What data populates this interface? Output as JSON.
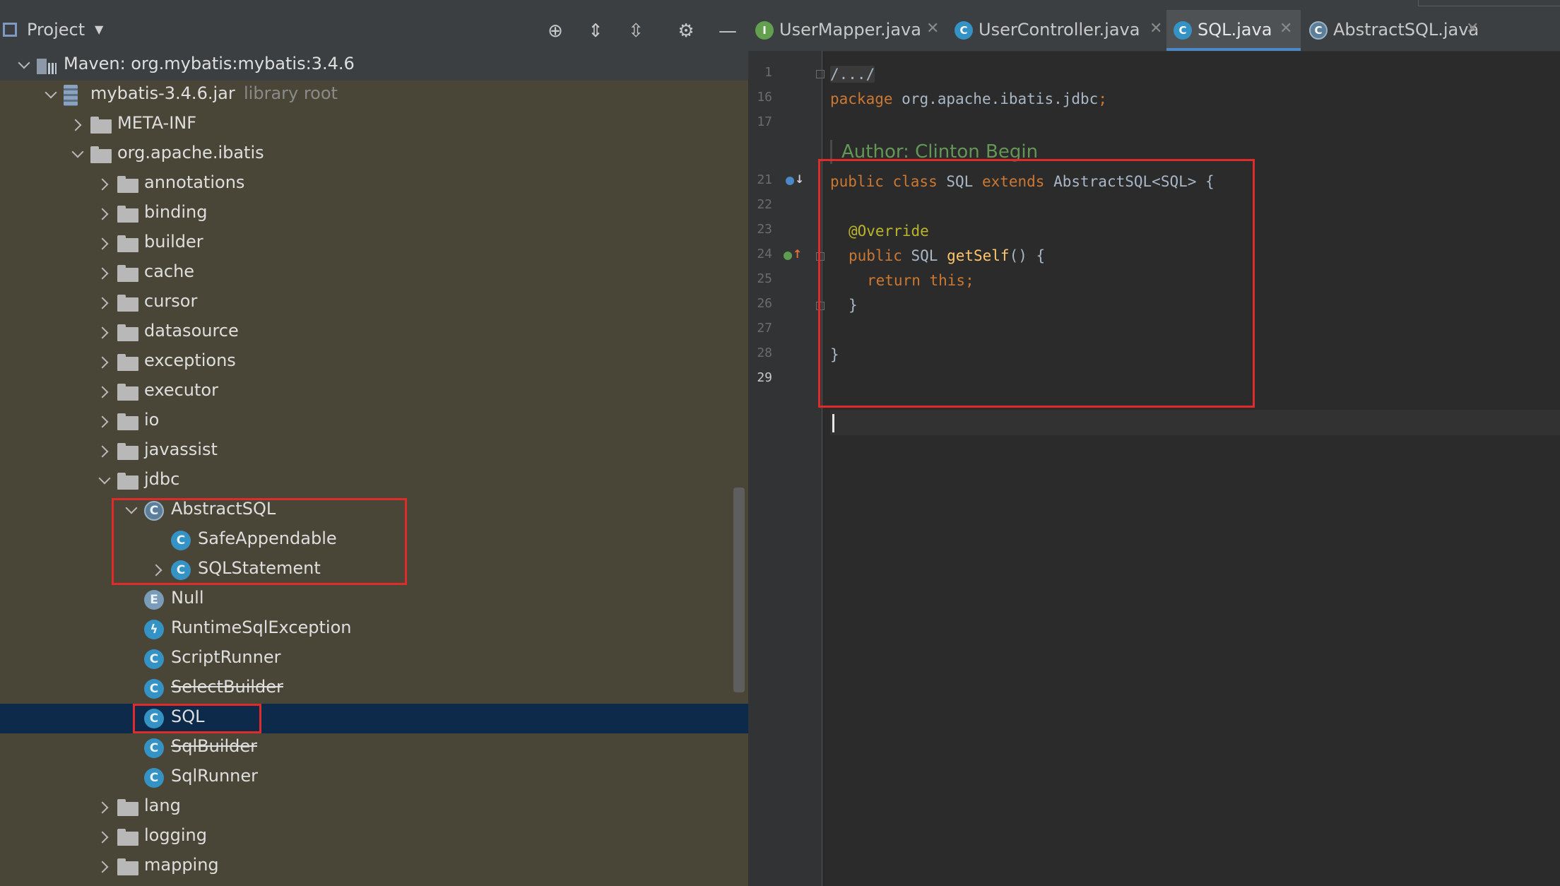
{
  "project_panel": {
    "title": "Project",
    "toolbar": [
      "target-icon",
      "expand-all-icon",
      "collapse-all-icon",
      "gear-icon",
      "minimize-icon"
    ],
    "tree": [
      {
        "label": "Maven: org.mybatis:mybatis:3.4.6",
        "type": "maven",
        "indent": 0,
        "expanded": true
      },
      {
        "label": "mybatis-3.4.6.jar",
        "suffix": "library root",
        "type": "jar",
        "indent": 1,
        "expanded": true
      },
      {
        "label": "META-INF",
        "type": "folder",
        "indent": 2,
        "expanded": false
      },
      {
        "label": "org.apache.ibatis",
        "type": "folder",
        "indent": 2,
        "expanded": true
      },
      {
        "label": "annotations",
        "type": "folder",
        "indent": 3,
        "expanded": false
      },
      {
        "label": "binding",
        "type": "folder",
        "indent": 3,
        "expanded": false
      },
      {
        "label": "builder",
        "type": "folder",
        "indent": 3,
        "expanded": false
      },
      {
        "label": "cache",
        "type": "folder",
        "indent": 3,
        "expanded": false
      },
      {
        "label": "cursor",
        "type": "folder",
        "indent": 3,
        "expanded": false
      },
      {
        "label": "datasource",
        "type": "folder",
        "indent": 3,
        "expanded": false
      },
      {
        "label": "exceptions",
        "type": "folder",
        "indent": 3,
        "expanded": false
      },
      {
        "label": "executor",
        "type": "folder",
        "indent": 3,
        "expanded": false
      },
      {
        "label": "io",
        "type": "folder",
        "indent": 3,
        "expanded": false
      },
      {
        "label": "javassist",
        "type": "folder",
        "indent": 3,
        "expanded": false
      },
      {
        "label": "jdbc",
        "type": "folder",
        "indent": 3,
        "expanded": true
      },
      {
        "label": "AbstractSQL",
        "type": "abstract",
        "indent": 4,
        "expanded": true
      },
      {
        "label": "SafeAppendable",
        "type": "class",
        "indent": 5,
        "expanded": null
      },
      {
        "label": "SQLStatement",
        "type": "class",
        "indent": 5,
        "expanded": false
      },
      {
        "label": "Null",
        "type": "enum",
        "indent": 4,
        "expanded": null
      },
      {
        "label": "RuntimeSqlException",
        "type": "exception",
        "indent": 4,
        "expanded": null
      },
      {
        "label": "ScriptRunner",
        "type": "class",
        "indent": 4,
        "expanded": null
      },
      {
        "label": "SelectBuilder",
        "type": "class",
        "indent": 4,
        "expanded": null,
        "deprecated": true
      },
      {
        "label": "SQL",
        "type": "class",
        "indent": 4,
        "expanded": null,
        "selected": true
      },
      {
        "label": "SqlBuilder",
        "type": "class",
        "indent": 4,
        "expanded": null,
        "deprecated": true
      },
      {
        "label": "SqlRunner",
        "type": "class",
        "indent": 4,
        "expanded": null
      },
      {
        "label": "lang",
        "type": "folder",
        "indent": 3,
        "expanded": false
      },
      {
        "label": "logging",
        "type": "folder",
        "indent": 3,
        "expanded": false
      },
      {
        "label": "mapping",
        "type": "folder",
        "indent": 3,
        "expanded": false
      }
    ]
  },
  "editor": {
    "tabs": [
      {
        "label": "UserMapper.java",
        "icon": "I",
        "kind": "interface",
        "active": false
      },
      {
        "label": "UserController.java",
        "icon": "C",
        "kind": "class",
        "active": false
      },
      {
        "label": "SQL.java",
        "icon": "C",
        "kind": "class",
        "active": true
      },
      {
        "label": "AbstractSQL.java",
        "icon": "C",
        "kind": "abstract",
        "active": false
      }
    ],
    "line_numbers": [
      "1",
      "16",
      "17",
      "21",
      "22",
      "23",
      "24",
      "25",
      "26",
      "27",
      "28",
      "29"
    ],
    "current_line": "29",
    "author_doc": "Author: Clinton Begin",
    "code": {
      "line1": "/.../",
      "package_kw": "package",
      "package_name": " org.apache.ibatis.jdbc",
      "package_semi": ";",
      "class_kw1": "public class",
      "class_name": " SQL ",
      "class_kw2": "extends",
      "class_rest": " AbstractSQL<SQL> {",
      "annotation": "@Override",
      "method_kw": "public",
      "method_type": " SQL ",
      "method_name": "getSelf",
      "method_rest": "() {",
      "return_kw": "return this",
      "return_semi": ";",
      "close_method": "}",
      "close_class": "}"
    }
  },
  "colors": {
    "highlight_box": "#e02b2b",
    "selection": "#0d2a4a",
    "tree_background": "#4a4637",
    "editor_background": "#2b2b2b",
    "keyword": "#cc7832",
    "annotation": "#bbb529",
    "method_name": "#ffc66d",
    "doc_comment": "#629755"
  }
}
